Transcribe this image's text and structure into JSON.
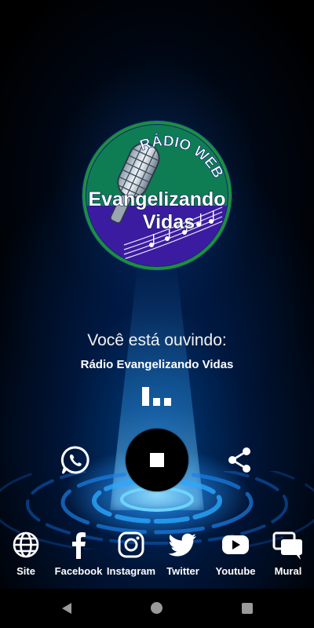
{
  "logo": {
    "top_text": "RÁDIO WEB",
    "line1": "Evangelizando",
    "line2": "Vidas",
    "colors": {
      "ring": "#1e8e3e",
      "top": "#0f7d54",
      "bottom": "#3b1ca0"
    }
  },
  "player": {
    "now_label": "Você está ouvindo:",
    "station": "Rádio Evangelizando Vidas",
    "state": "playing"
  },
  "controls": {
    "whatsapp_icon": "whatsapp-icon",
    "stop_icon": "stop-icon",
    "share_icon": "share-icon"
  },
  "social": [
    {
      "label": "Site",
      "icon": "globe-icon"
    },
    {
      "label": "Facebook",
      "icon": "facebook-icon"
    },
    {
      "label": "Instagram",
      "icon": "instagram-icon"
    },
    {
      "label": "Twitter",
      "icon": "twitter-icon"
    },
    {
      "label": "Youtube",
      "icon": "youtube-icon"
    },
    {
      "label": "Mural",
      "icon": "chat-icon"
    }
  ],
  "colors": {
    "accent": "#1a8cff",
    "background": "#000000",
    "text": "#ffffff"
  }
}
